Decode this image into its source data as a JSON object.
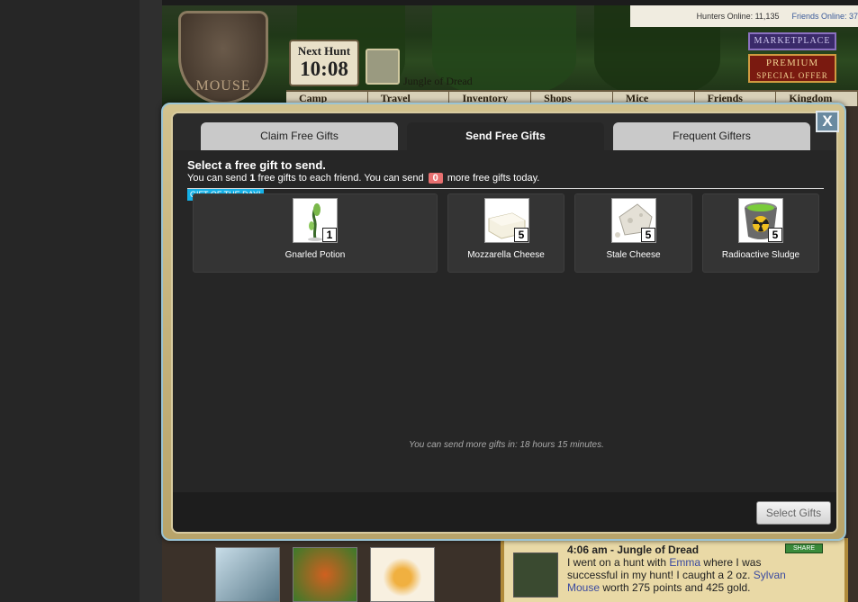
{
  "game_header": {
    "hunters_online": "Hunters Online: 11,135",
    "friends_online": "Friends Online: 37",
    "crest_text": "MOUSE",
    "next_hunt_label": "Next Hunt",
    "next_hunt_time": "10:08",
    "location": "Jungle of Dread",
    "marketplace": "MARKETPLACE",
    "premium": "PREMIUM",
    "special_offer": "SPECIAL OFFER",
    "nav": [
      "Camp",
      "Travel",
      "Inventory",
      "Shops",
      "Mice",
      "Friends",
      "Kingdom"
    ]
  },
  "modal": {
    "close_label": "X",
    "tabs": [
      {
        "label": "Claim Free Gifts",
        "active": false
      },
      {
        "label": "Send Free Gifts",
        "active": true
      },
      {
        "label": "Frequent Gifters",
        "active": false
      }
    ],
    "title": "Select a free gift to send.",
    "info_prefix": "You can send ",
    "per_friend": "1",
    "info_middle": " free gifts to each friend. You can send ",
    "remaining": "0",
    "info_suffix": " more free gifts today.",
    "gift_of_the_day_label": "GIFT OF THE DAY!",
    "gifts": [
      {
        "name": "Gnarled Potion",
        "quantity": "1",
        "icon": "gnarled-potion-icon"
      },
      {
        "name": "Mozzarella Cheese",
        "quantity": "5",
        "icon": "mozzarella-cheese-icon"
      },
      {
        "name": "Stale Cheese",
        "quantity": "5",
        "icon": "stale-cheese-icon"
      },
      {
        "name": "Radioactive Sludge",
        "quantity": "5",
        "icon": "radioactive-sludge-icon"
      }
    ],
    "footer_note": "You can send more gifts in: 18 hours 15 minutes.",
    "select_button": "Select Gifts"
  },
  "journal": {
    "title": "4:06 am - Jungle of Dread",
    "share": "SHARE",
    "text_1": "I went on a hunt with ",
    "hunter": "Emma",
    "text_2": " where I was successful in my hunt! I caught a 2 oz. ",
    "mouse_name": "Sylvan Mouse",
    "text_3": " worth 275 points and 425 gold."
  }
}
